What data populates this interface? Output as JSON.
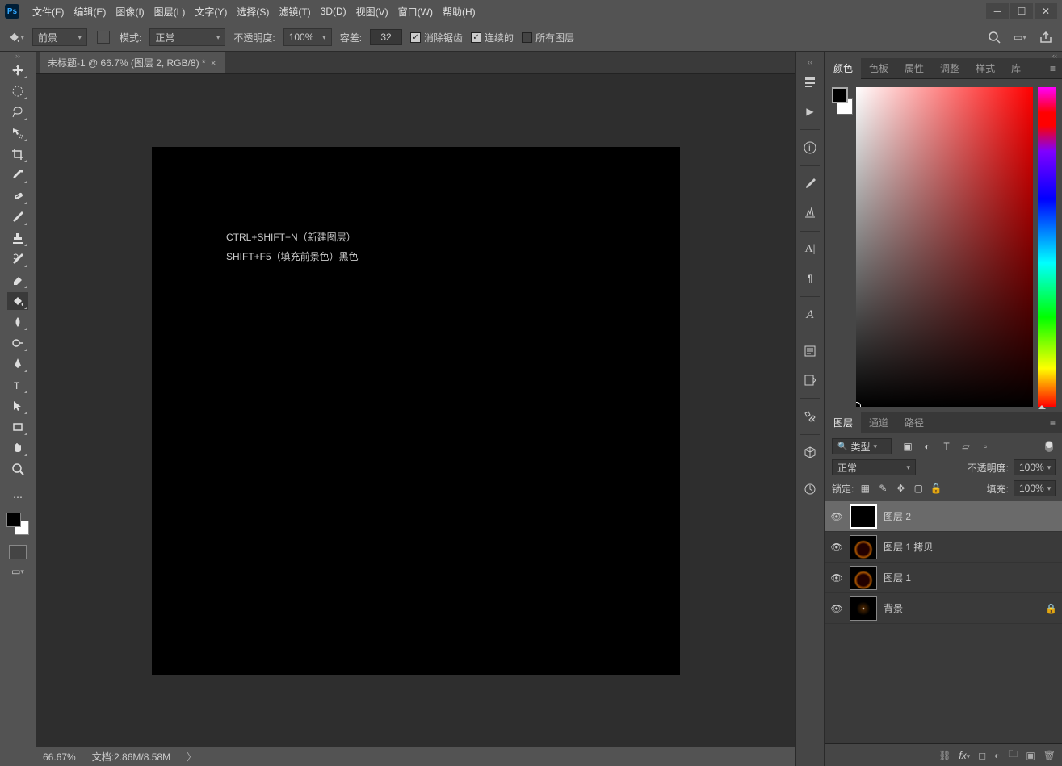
{
  "menu": {
    "file": "文件(F)",
    "edit": "编辑(E)",
    "image": "图像(I)",
    "layer": "图层(L)",
    "type": "文字(Y)",
    "select": "选择(S)",
    "filter": "滤镜(T)",
    "three_d": "3D(D)",
    "view": "视图(V)",
    "window": "窗口(W)",
    "help": "帮助(H)"
  },
  "options": {
    "fill_target": "前景",
    "mode_label": "模式:",
    "mode_value": "正常",
    "opacity_label": "不透明度:",
    "opacity_value": "100%",
    "tolerance_label": "容差:",
    "tolerance_value": "32",
    "antialias": "消除锯齿",
    "contiguous": "连续的",
    "all_layers": "所有图层"
  },
  "doc": {
    "tab_title": "未标题-1 @ 66.7% (图层 2, RGB/8) *"
  },
  "canvas_text": {
    "line1": "CTRL+SHIFT+N（新建图层）",
    "line2": "SHIFT+F5（填充前景色）黑色"
  },
  "status": {
    "zoom": "66.67%",
    "doc": "文档:2.86M/8.58M"
  },
  "right_tabs": {
    "color": "颜色",
    "swatches": "色板",
    "properties": "属性",
    "adjust": "调整",
    "styles": "样式",
    "libraries": "库"
  },
  "layers_tabs": {
    "layers": "图层",
    "channels": "通道",
    "paths": "路径"
  },
  "layers_controls": {
    "kind_label": "类型",
    "blend": "正常",
    "opacity_label": "不透明度:",
    "opacity": "100%",
    "lock_label": "锁定:",
    "fill_label": "填充:",
    "fill": "100%"
  },
  "layers": [
    {
      "name": "图层 2",
      "selected": true,
      "thumb": "black"
    },
    {
      "name": "图层 1 拷贝",
      "selected": false,
      "thumb": "eclipse"
    },
    {
      "name": "图层 1",
      "selected": false,
      "thumb": "eclipse"
    },
    {
      "name": "背景",
      "selected": false,
      "thumb": "star",
      "locked": true
    }
  ]
}
